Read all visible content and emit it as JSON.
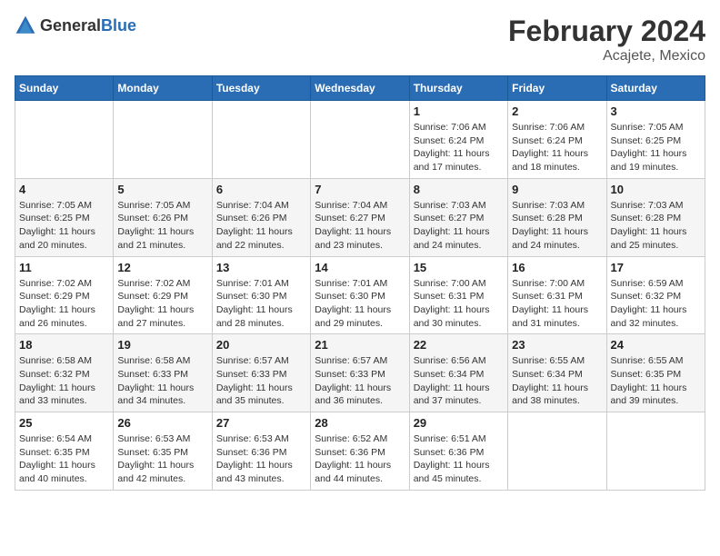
{
  "logo": {
    "text_general": "General",
    "text_blue": "Blue"
  },
  "title": "February 2024",
  "subtitle": "Acajete, Mexico",
  "weekdays": [
    "Sunday",
    "Monday",
    "Tuesday",
    "Wednesday",
    "Thursday",
    "Friday",
    "Saturday"
  ],
  "weeks": [
    [
      {
        "day": "",
        "sunrise": "",
        "sunset": "",
        "daylight": ""
      },
      {
        "day": "",
        "sunrise": "",
        "sunset": "",
        "daylight": ""
      },
      {
        "day": "",
        "sunrise": "",
        "sunset": "",
        "daylight": ""
      },
      {
        "day": "",
        "sunrise": "",
        "sunset": "",
        "daylight": ""
      },
      {
        "day": "1",
        "sunrise": "Sunrise: 7:06 AM",
        "sunset": "Sunset: 6:24 PM",
        "daylight": "Daylight: 11 hours and 17 minutes."
      },
      {
        "day": "2",
        "sunrise": "Sunrise: 7:06 AM",
        "sunset": "Sunset: 6:24 PM",
        "daylight": "Daylight: 11 hours and 18 minutes."
      },
      {
        "day": "3",
        "sunrise": "Sunrise: 7:05 AM",
        "sunset": "Sunset: 6:25 PM",
        "daylight": "Daylight: 11 hours and 19 minutes."
      }
    ],
    [
      {
        "day": "4",
        "sunrise": "Sunrise: 7:05 AM",
        "sunset": "Sunset: 6:25 PM",
        "daylight": "Daylight: 11 hours and 20 minutes."
      },
      {
        "day": "5",
        "sunrise": "Sunrise: 7:05 AM",
        "sunset": "Sunset: 6:26 PM",
        "daylight": "Daylight: 11 hours and 21 minutes."
      },
      {
        "day": "6",
        "sunrise": "Sunrise: 7:04 AM",
        "sunset": "Sunset: 6:26 PM",
        "daylight": "Daylight: 11 hours and 22 minutes."
      },
      {
        "day": "7",
        "sunrise": "Sunrise: 7:04 AM",
        "sunset": "Sunset: 6:27 PM",
        "daylight": "Daylight: 11 hours and 23 minutes."
      },
      {
        "day": "8",
        "sunrise": "Sunrise: 7:03 AM",
        "sunset": "Sunset: 6:27 PM",
        "daylight": "Daylight: 11 hours and 24 minutes."
      },
      {
        "day": "9",
        "sunrise": "Sunrise: 7:03 AM",
        "sunset": "Sunset: 6:28 PM",
        "daylight": "Daylight: 11 hours and 24 minutes."
      },
      {
        "day": "10",
        "sunrise": "Sunrise: 7:03 AM",
        "sunset": "Sunset: 6:28 PM",
        "daylight": "Daylight: 11 hours and 25 minutes."
      }
    ],
    [
      {
        "day": "11",
        "sunrise": "Sunrise: 7:02 AM",
        "sunset": "Sunset: 6:29 PM",
        "daylight": "Daylight: 11 hours and 26 minutes."
      },
      {
        "day": "12",
        "sunrise": "Sunrise: 7:02 AM",
        "sunset": "Sunset: 6:29 PM",
        "daylight": "Daylight: 11 hours and 27 minutes."
      },
      {
        "day": "13",
        "sunrise": "Sunrise: 7:01 AM",
        "sunset": "Sunset: 6:30 PM",
        "daylight": "Daylight: 11 hours and 28 minutes."
      },
      {
        "day": "14",
        "sunrise": "Sunrise: 7:01 AM",
        "sunset": "Sunset: 6:30 PM",
        "daylight": "Daylight: 11 hours and 29 minutes."
      },
      {
        "day": "15",
        "sunrise": "Sunrise: 7:00 AM",
        "sunset": "Sunset: 6:31 PM",
        "daylight": "Daylight: 11 hours and 30 minutes."
      },
      {
        "day": "16",
        "sunrise": "Sunrise: 7:00 AM",
        "sunset": "Sunset: 6:31 PM",
        "daylight": "Daylight: 11 hours and 31 minutes."
      },
      {
        "day": "17",
        "sunrise": "Sunrise: 6:59 AM",
        "sunset": "Sunset: 6:32 PM",
        "daylight": "Daylight: 11 hours and 32 minutes."
      }
    ],
    [
      {
        "day": "18",
        "sunrise": "Sunrise: 6:58 AM",
        "sunset": "Sunset: 6:32 PM",
        "daylight": "Daylight: 11 hours and 33 minutes."
      },
      {
        "day": "19",
        "sunrise": "Sunrise: 6:58 AM",
        "sunset": "Sunset: 6:33 PM",
        "daylight": "Daylight: 11 hours and 34 minutes."
      },
      {
        "day": "20",
        "sunrise": "Sunrise: 6:57 AM",
        "sunset": "Sunset: 6:33 PM",
        "daylight": "Daylight: 11 hours and 35 minutes."
      },
      {
        "day": "21",
        "sunrise": "Sunrise: 6:57 AM",
        "sunset": "Sunset: 6:33 PM",
        "daylight": "Daylight: 11 hours and 36 minutes."
      },
      {
        "day": "22",
        "sunrise": "Sunrise: 6:56 AM",
        "sunset": "Sunset: 6:34 PM",
        "daylight": "Daylight: 11 hours and 37 minutes."
      },
      {
        "day": "23",
        "sunrise": "Sunrise: 6:55 AM",
        "sunset": "Sunset: 6:34 PM",
        "daylight": "Daylight: 11 hours and 38 minutes."
      },
      {
        "day": "24",
        "sunrise": "Sunrise: 6:55 AM",
        "sunset": "Sunset: 6:35 PM",
        "daylight": "Daylight: 11 hours and 39 minutes."
      }
    ],
    [
      {
        "day": "25",
        "sunrise": "Sunrise: 6:54 AM",
        "sunset": "Sunset: 6:35 PM",
        "daylight": "Daylight: 11 hours and 40 minutes."
      },
      {
        "day": "26",
        "sunrise": "Sunrise: 6:53 AM",
        "sunset": "Sunset: 6:35 PM",
        "daylight": "Daylight: 11 hours and 42 minutes."
      },
      {
        "day": "27",
        "sunrise": "Sunrise: 6:53 AM",
        "sunset": "Sunset: 6:36 PM",
        "daylight": "Daylight: 11 hours and 43 minutes."
      },
      {
        "day": "28",
        "sunrise": "Sunrise: 6:52 AM",
        "sunset": "Sunset: 6:36 PM",
        "daylight": "Daylight: 11 hours and 44 minutes."
      },
      {
        "day": "29",
        "sunrise": "Sunrise: 6:51 AM",
        "sunset": "Sunset: 6:36 PM",
        "daylight": "Daylight: 11 hours and 45 minutes."
      },
      {
        "day": "",
        "sunrise": "",
        "sunset": "",
        "daylight": ""
      },
      {
        "day": "",
        "sunrise": "",
        "sunset": "",
        "daylight": ""
      }
    ]
  ]
}
